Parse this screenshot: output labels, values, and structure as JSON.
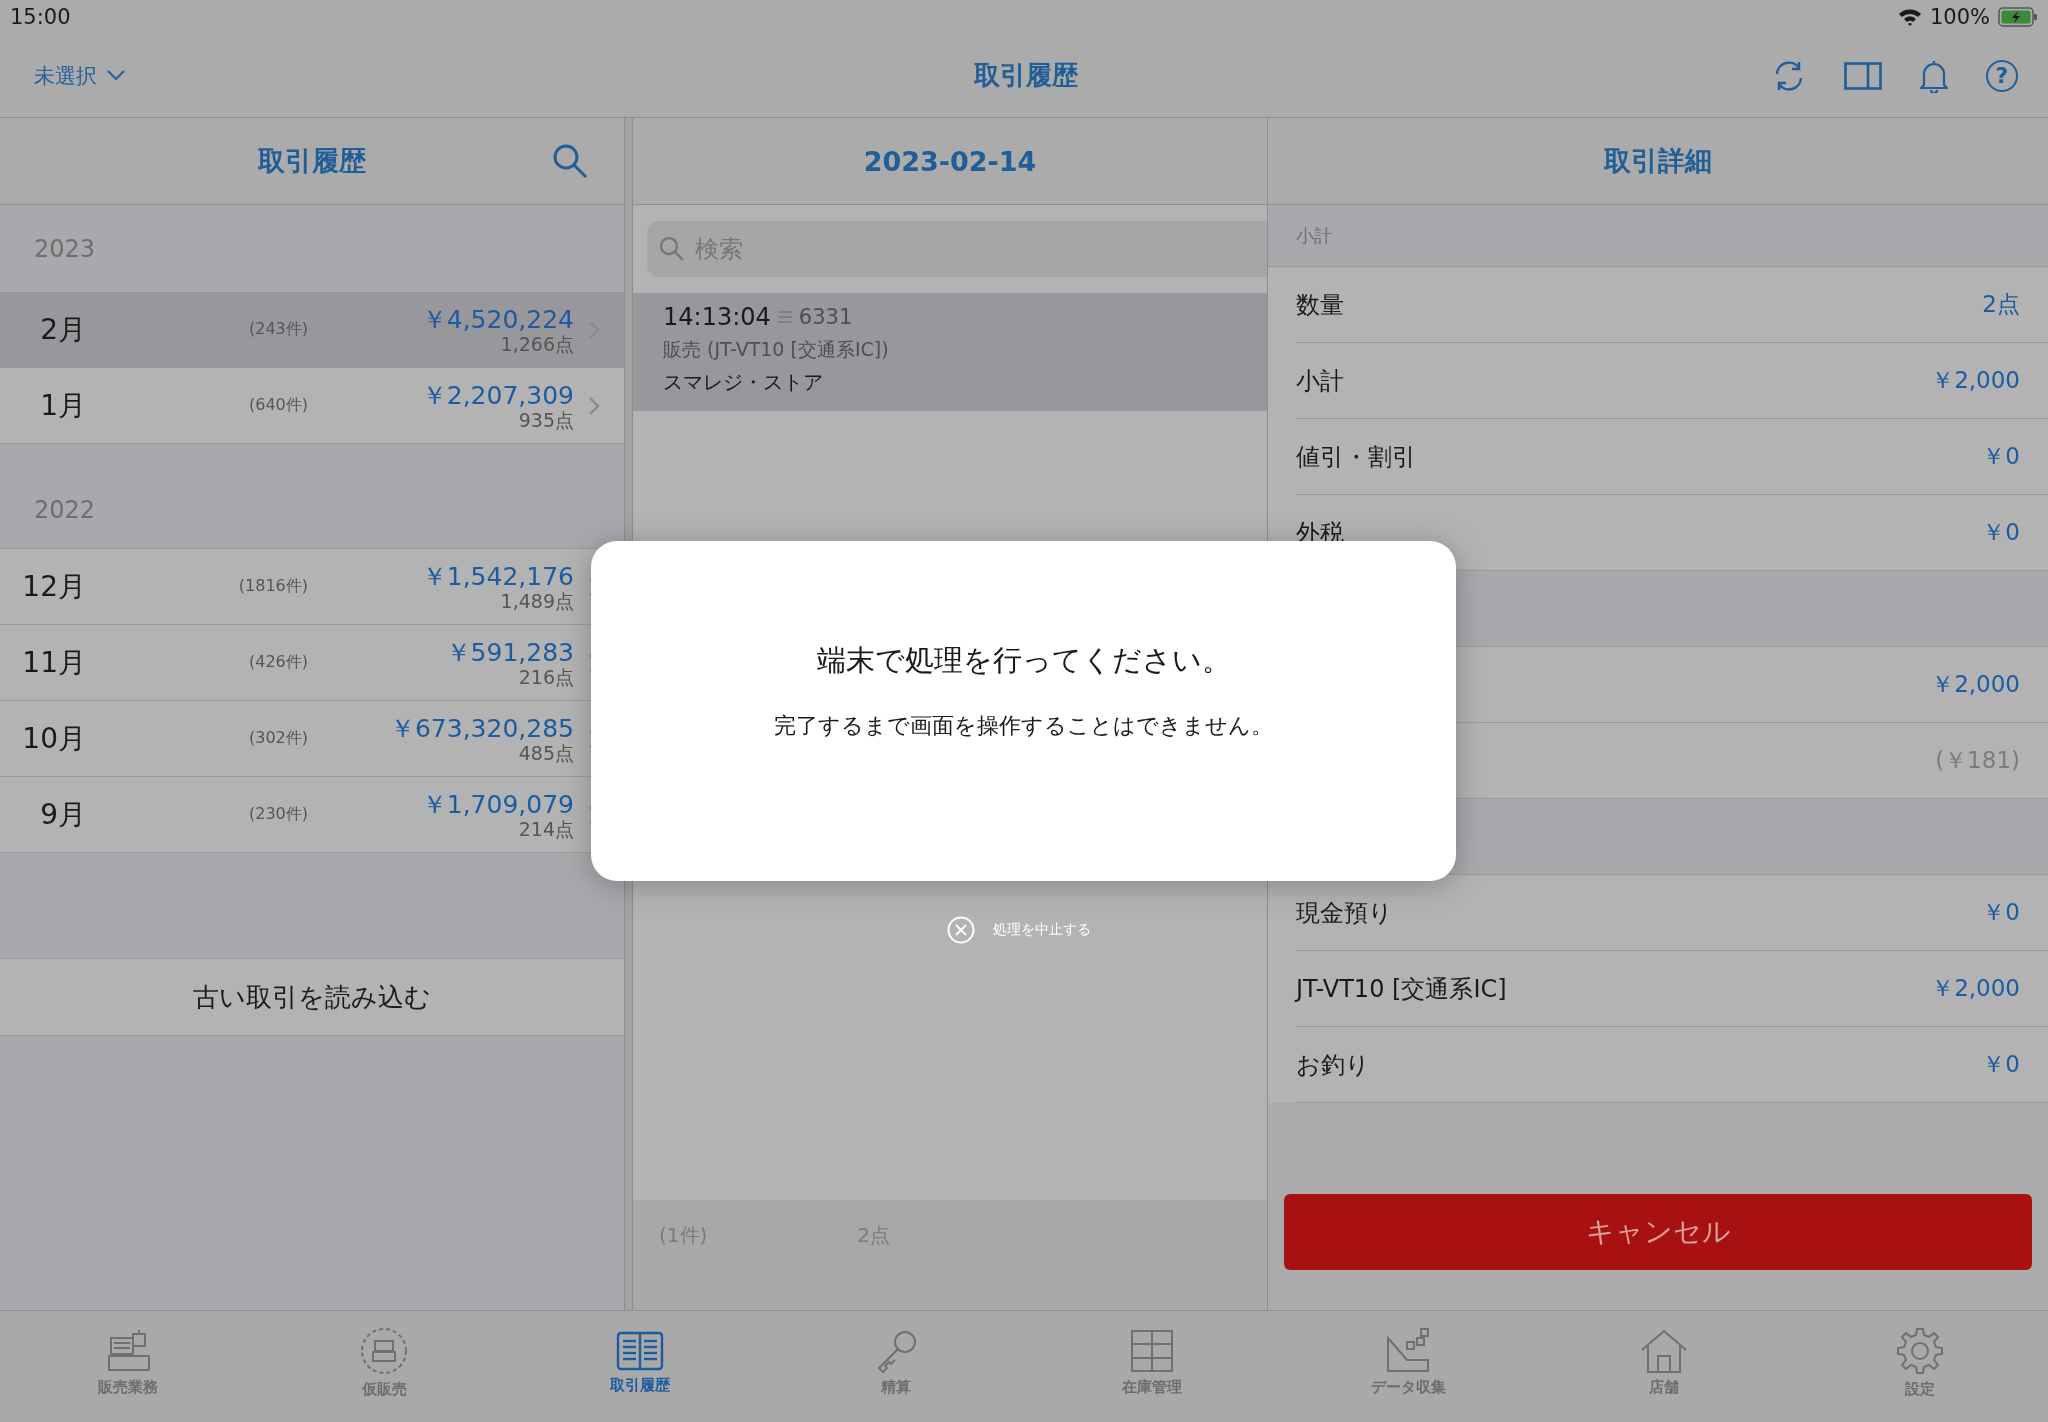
{
  "status_bar": {
    "time": "15:00",
    "battery": "100%"
  },
  "nav": {
    "store_selector": "未選択",
    "title": "取引履歴",
    "help": "?"
  },
  "left": {
    "title": "取引履歴",
    "groups": [
      {
        "year": "2023",
        "months": [
          {
            "month": "2月",
            "count": "(243件)",
            "amount": "￥4,520,224",
            "items": "1,266点",
            "selected": true
          },
          {
            "month": "1月",
            "count": "(640件)",
            "amount": "￥2,207,309",
            "items": "935点",
            "selected": false
          }
        ]
      },
      {
        "year": "2022",
        "months": [
          {
            "month": "12月",
            "count": "(1816件)",
            "amount": "￥1,542,176",
            "items": "1,489点",
            "selected": false
          },
          {
            "month": "11月",
            "count": "(426件)",
            "amount": "￥591,283",
            "items": "216点",
            "selected": false
          },
          {
            "month": "10月",
            "count": "(302件)",
            "amount": "￥673,320,285",
            "items": "485点",
            "selected": false
          },
          {
            "month": "9月",
            "count": "(230件)",
            "amount": "￥1,709,079",
            "items": "214点",
            "selected": false
          }
        ]
      }
    ],
    "load_button": "古い取引を読み込む"
  },
  "middle": {
    "date": "2023-02-14",
    "search_placeholder": "検索",
    "transactions": [
      {
        "time": "14:13:04",
        "number": "6331",
        "type": "販売 (JT-VT10 [交通系IC])",
        "store": "スマレジ・ストア",
        "selected": true
      }
    ],
    "footer": {
      "count": "(1件)",
      "items": "2点"
    }
  },
  "right": {
    "title": "取引詳細",
    "sections": [
      {
        "title": "小計",
        "rows": [
          {
            "label": "数量",
            "value": "2点",
            "kind": "amount"
          },
          {
            "label": "小計",
            "value": "￥2,000",
            "kind": "amount"
          },
          {
            "label": "値引・割引",
            "value": "￥0",
            "kind": "amount"
          },
          {
            "label": "外税",
            "value": "￥0",
            "kind": "amount"
          }
        ]
      },
      {
        "rows": [
          {
            "value": "￥2,000",
            "kind": "amount"
          },
          {
            "value": "(￥181)",
            "kind": "note"
          }
        ]
      },
      {
        "rows": [
          {
            "label": "現金預り",
            "value": "￥0",
            "kind": "amount"
          },
          {
            "label": "JT-VT10 [交通系IC]",
            "value": "￥2,000",
            "kind": "amount"
          },
          {
            "label": "お釣り",
            "value": "￥0",
            "kind": "amount"
          }
        ]
      }
    ],
    "cancel_button": "キャンセル"
  },
  "modal": {
    "title": "端末で処理を行ってください。",
    "message": "完了するまで画面を操作することはできません。",
    "abort": "処理を中止する"
  },
  "tabs": [
    {
      "label": "販売業務",
      "kind": "register",
      "selected": false
    },
    {
      "label": "仮販売",
      "kind": "temp",
      "selected": false
    },
    {
      "label": "取引履歴",
      "kind": "history",
      "selected": true
    },
    {
      "label": "精算",
      "kind": "key",
      "selected": false
    },
    {
      "label": "在庫管理",
      "kind": "stock",
      "selected": false
    },
    {
      "label": "データ収集",
      "kind": "data",
      "selected": false
    },
    {
      "label": "店舗",
      "kind": "store",
      "selected": false
    },
    {
      "label": "設定",
      "kind": "settings",
      "selected": false
    }
  ]
}
